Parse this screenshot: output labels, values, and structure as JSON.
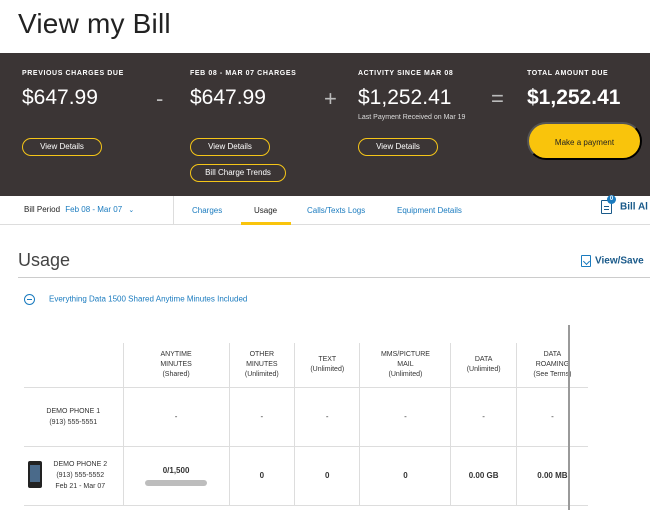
{
  "page": {
    "title": "View my Bill"
  },
  "summary": {
    "previous": {
      "label": "PREVIOUS CHARGES DUE",
      "amount": "$647.99",
      "button": "View Details"
    },
    "op1": "-",
    "current": {
      "label": "FEB 08 - MAR 07 CHARGES",
      "amount": "$647.99",
      "button": "View Details",
      "button2": "Bill Charge Trends"
    },
    "op2": "+",
    "activity": {
      "label": "ACTIVITY SINCE MAR 08",
      "amount": "$1,252.41",
      "sub": "Last Payment Received on Mar 19",
      "button": "View Details"
    },
    "op3": "=",
    "total": {
      "label": "TOTAL AMOUNT DUE",
      "amount": "$1,252.41",
      "button": "Make a payment"
    }
  },
  "tabbar": {
    "bill_period_label": "Bill Period",
    "bill_period_value": "Feb 08 - Mar 07",
    "tabs": [
      "Charges",
      "Usage",
      "Calls/Texts Logs",
      "Equipment Details"
    ],
    "active_tab": "Usage",
    "bill_all_label": "Bill Al",
    "badge": "0"
  },
  "usage": {
    "title": "Usage",
    "view_save": "View/Save",
    "plan": "Everything Data 1500 Shared Anytime Minutes Included",
    "columns": [
      [
        "ANYTIME",
        "MINUTES",
        "(Shared)"
      ],
      [
        "OTHER",
        "MINUTES",
        "(Unlimited)"
      ],
      [
        "TEXT",
        "(Unlimited)"
      ],
      [
        "MMS/PICTURE",
        "MAIL",
        "(Unlimited)"
      ],
      [
        "DATA",
        "(Unlimited)"
      ],
      [
        "DATA",
        "ROAMING",
        "(See Terms)"
      ]
    ],
    "rows": [
      {
        "device": [
          "DEMO PHONE 1",
          "(913) 555-5551"
        ],
        "values": [
          "-",
          "-",
          "-",
          "-",
          "-",
          "-"
        ]
      },
      {
        "device": [
          "DEMO PHONE 2",
          "(913) 555-5552",
          "Feb 21 - Mar 07"
        ],
        "values": [
          "0/1,500",
          "0",
          "0",
          "0",
          "0.00 GB",
          "0.00 MB"
        ],
        "anytime_used_fraction": 0
      }
    ]
  },
  "colors": {
    "summary_bg": "#3b3535",
    "accent_yellow": "#f9c40c",
    "link_blue": "#1a7bbf"
  }
}
